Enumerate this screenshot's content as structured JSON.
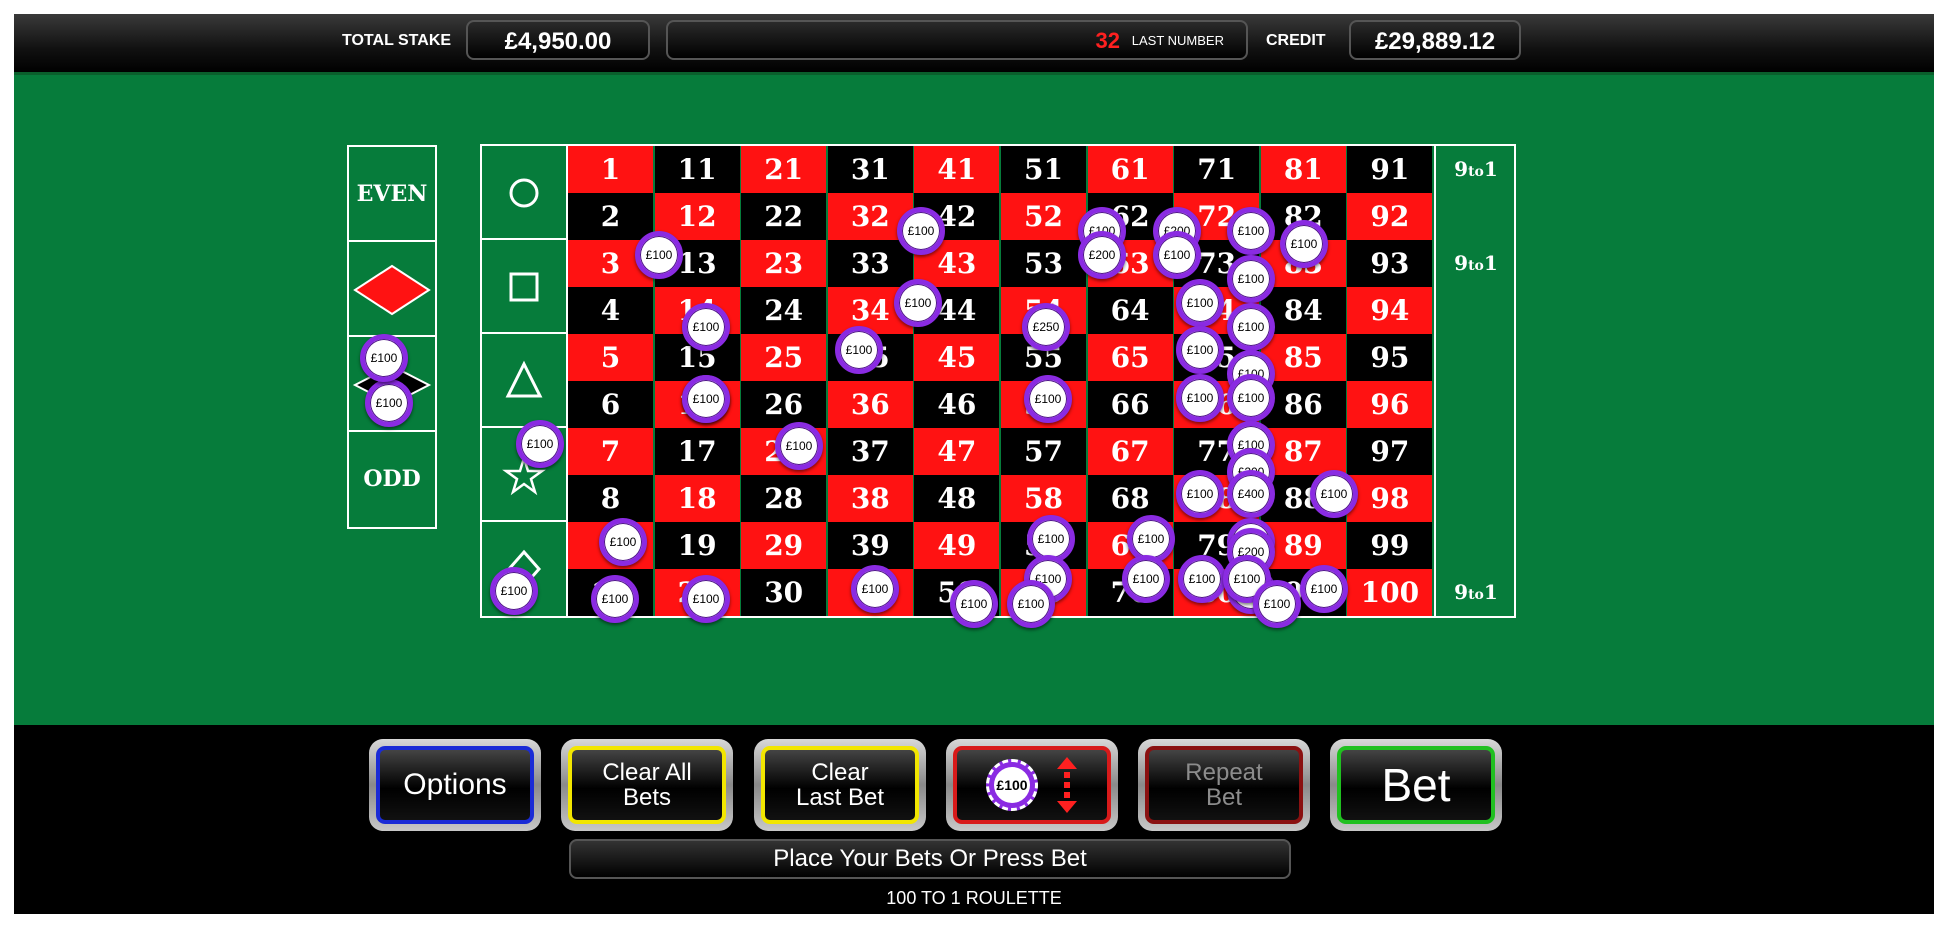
{
  "topbar": {
    "total_stake_label": "TOTAL STAKE",
    "total_stake_value": "£4,950.00",
    "last_number_value": "32",
    "last_number_label": "LAST NUMBER",
    "credit_label": "CREDIT",
    "credit_value": "£29,889.12"
  },
  "side_bets": {
    "even_label": "EVEN",
    "odd_label": "ODD",
    "chip_value": "£100"
  },
  "grid": {
    "rows": [
      [
        1,
        11,
        21,
        31,
        41,
        51,
        61,
        71,
        81,
        91
      ],
      [
        2,
        12,
        22,
        32,
        42,
        52,
        62,
        72,
        82,
        92
      ],
      [
        3,
        13,
        23,
        33,
        43,
        53,
        63,
        73,
        83,
        93
      ],
      [
        4,
        14,
        24,
        34,
        44,
        54,
        64,
        74,
        84,
        94
      ],
      [
        5,
        15,
        25,
        35,
        45,
        55,
        65,
        75,
        85,
        95
      ],
      [
        6,
        16,
        26,
        36,
        46,
        56,
        66,
        76,
        86,
        96
      ],
      [
        7,
        17,
        27,
        37,
        47,
        57,
        67,
        77,
        87,
        97
      ],
      [
        8,
        18,
        28,
        38,
        48,
        58,
        68,
        78,
        88,
        98
      ],
      [
        9,
        19,
        29,
        39,
        49,
        59,
        69,
        79,
        89,
        99
      ],
      [
        10,
        20,
        30,
        40,
        50,
        60,
        70,
        80,
        90,
        100
      ]
    ],
    "red_numbers": [
      1,
      3,
      5,
      7,
      9,
      12,
      14,
      16,
      18,
      20,
      21,
      23,
      25,
      27,
      29,
      32,
      34,
      36,
      38,
      40,
      41,
      43,
      45,
      47,
      49,
      52,
      54,
      56,
      58,
      60,
      61,
      63,
      65,
      67,
      69,
      72,
      74,
      76,
      78,
      80,
      81,
      83,
      85,
      87,
      89,
      92,
      94,
      96,
      98,
      100
    ],
    "payout_a": "9",
    "payout_to": "to",
    "payout_b": "1"
  },
  "chips": [
    "£100",
    "£100",
    "£100",
    "£200",
    "£100",
    "£200",
    "£100",
    "£100",
    "£100",
    "£100",
    "£250",
    "£100",
    "£100",
    "£100",
    "£100",
    "£100",
    "£100",
    "£100",
    "£100",
    "£100",
    "£100",
    "£100",
    "£100",
    "£200",
    "£100",
    "£400",
    "£100",
    "£100",
    "£100",
    "£100",
    "£100",
    "£200",
    "£100",
    "£100",
    "£100",
    "£100",
    "£100",
    "£100",
    "£100",
    "£100",
    "£100",
    "£100",
    "£100",
    "£100",
    "£100",
    "£100",
    "£100",
    "£100"
  ],
  "buttons": {
    "options": "Options",
    "clear_all_1": "Clear All",
    "clear_all_2": "Bets",
    "clear_last_1": "Clear",
    "clear_last_2": "Last Bet",
    "chip_selector_value": "£100",
    "repeat_1": "Repeat",
    "repeat_2": "Bet",
    "bet": "Bet"
  },
  "colors": {
    "options": "#1a2bd6",
    "clear_all": "#f2e600",
    "clear_last": "#f2e600",
    "chip_selector": "#d81a1a",
    "repeat": "#8a1111",
    "bet": "#20c020",
    "felt": "#067c3b"
  },
  "message": "Place Your Bets Or Press Bet",
  "game_title": "100 TO 1 ROULETTE"
}
